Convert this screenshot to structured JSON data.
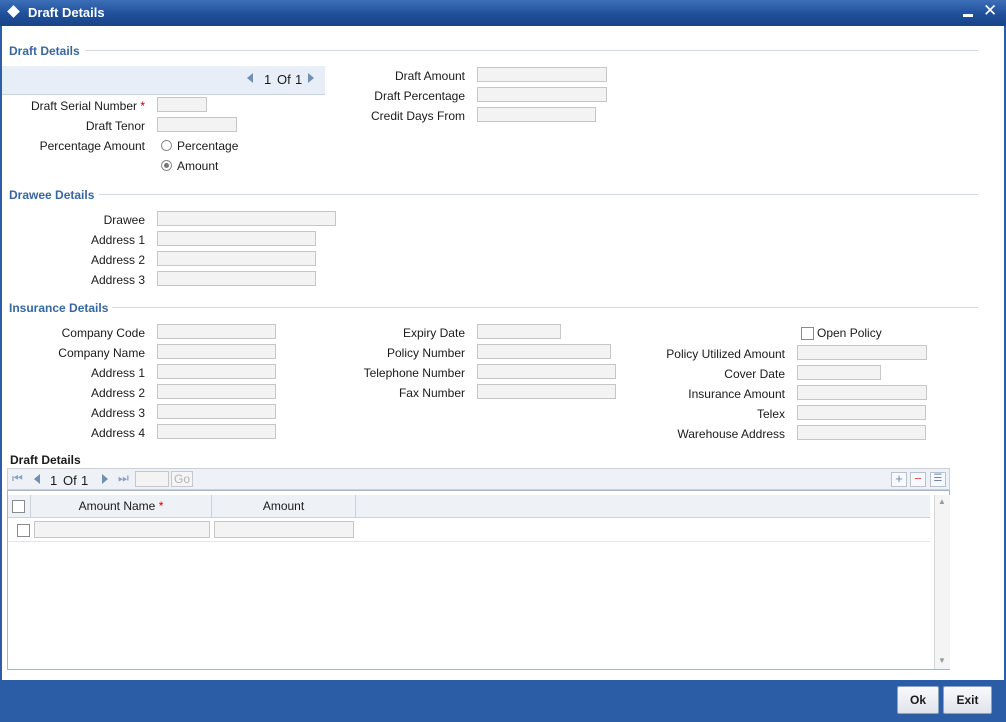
{
  "window": {
    "title": "Draft Details"
  },
  "draft": {
    "section": "Draft Details",
    "pager": {
      "current": "1",
      "of": "Of",
      "total": "1"
    },
    "serial_label": "Draft Serial Number",
    "tenor_label": "Draft Tenor",
    "pct_amt_label": "Percentage Amount",
    "opt_percentage": "Percentage",
    "opt_amount": "Amount",
    "selected_option": "Amount",
    "amount_label": "Draft Amount",
    "percentage_label": "Draft Percentage",
    "credit_days_label": "Credit Days From"
  },
  "drawee": {
    "section": "Drawee Details",
    "drawee_label": "Drawee",
    "addr1_label": "Address 1",
    "addr2_label": "Address 2",
    "addr3_label": "Address 3"
  },
  "insurance": {
    "section": "Insurance Details",
    "company_code_label": "Company Code",
    "company_name_label": "Company Name",
    "addr1_label": "Address 1",
    "addr2_label": "Address 2",
    "addr3_label": "Address 3",
    "addr4_label": "Address 4",
    "expiry_label": "Expiry Date",
    "policy_number_label": "Policy Number",
    "telephone_label": "Telephone Number",
    "fax_label": "Fax Number",
    "open_policy_label": "Open Policy",
    "policy_utilized_label": "Policy Utilized Amount",
    "cover_date_label": "Cover Date",
    "insurance_amount_label": "Insurance Amount",
    "telex_label": "Telex",
    "warehouse_label": "Warehouse Address"
  },
  "grid": {
    "title": "Draft Details",
    "pager": {
      "current": "1",
      "of": "Of",
      "total": "1"
    },
    "go_label": "Go",
    "columns": [
      "Amount Name",
      "Amount"
    ]
  },
  "footer": {
    "ok_label": "Ok",
    "exit_label": "Exit"
  },
  "colors": {
    "titlebar": "#1f4f98",
    "section": "#37679f",
    "footer": "#2b5ca6",
    "required": "#c40000"
  }
}
